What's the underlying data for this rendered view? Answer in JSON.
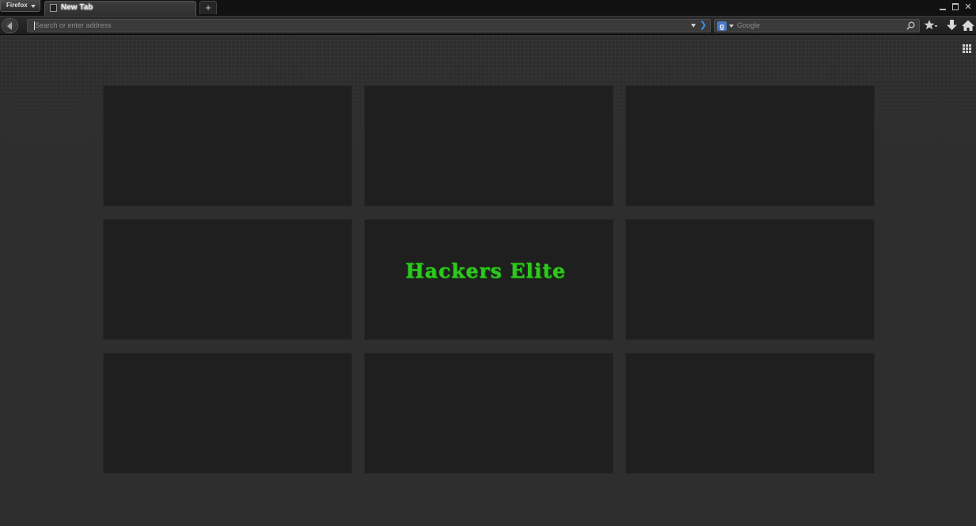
{
  "browser": {
    "menu_button_label": "Firefox",
    "tabs": [
      {
        "title": "New Tab",
        "active": true
      }
    ],
    "new_tab_label": "+",
    "window_controls": {
      "minimize_icon": "minimize-icon",
      "maximize_icon": "restore-icon",
      "close_label": "✕"
    }
  },
  "navbar": {
    "back_icon": "back-arrow-icon",
    "url_placeholder": "Search or enter address",
    "url_value": "",
    "go_label": "❯",
    "search": {
      "engine": "Google",
      "engine_icon_label": "g",
      "placeholder": "Google"
    },
    "icons": [
      "bookmark-star-icon",
      "download-icon",
      "home-icon"
    ]
  },
  "new_tab_page": {
    "grid_toggle_icon": "grid-icon",
    "tiles": [
      {
        "text": ""
      },
      {
        "text": ""
      },
      {
        "text": ""
      },
      {
        "text": ""
      },
      {
        "text": "Hackers Elite"
      },
      {
        "text": ""
      },
      {
        "text": ""
      },
      {
        "text": ""
      },
      {
        "text": ""
      }
    ]
  },
  "colors": {
    "accent_green": "#2fc81f",
    "go_arrow_blue": "#3b8fe6",
    "tile_background": "#1f1f1f",
    "page_background": "#2e2e2e"
  }
}
